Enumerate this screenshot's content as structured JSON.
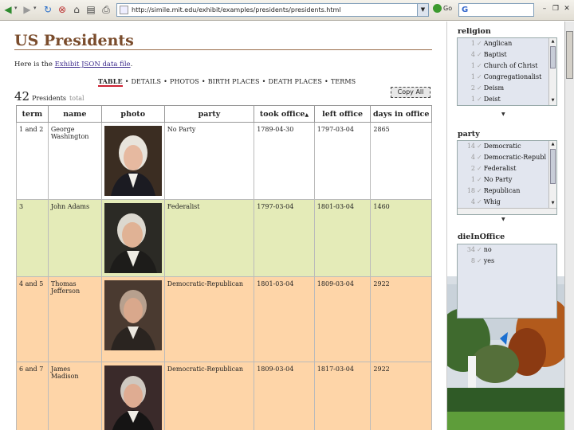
{
  "browser": {
    "url": "http://simile.mit.edu/exhibit/examples/presidents/presidents.html",
    "go_label": "Go",
    "search_logo": "G",
    "page_icon_text": "5"
  },
  "page": {
    "title": "US Presidents",
    "intro_before": "Here is the ",
    "intro_link": "Exhibit JSON data file",
    "intro_after": ".",
    "views": [
      "TABLE",
      "DETAILS",
      "PHOTOS",
      "BIRTH PLACES",
      "DEATH PLACES",
      "TERMS"
    ],
    "count_number": "42",
    "count_label": "Presidents",
    "count_total": "total",
    "copy_all": "Copy All"
  },
  "table": {
    "headers": [
      "term",
      "name",
      "photo",
      "party",
      "took office",
      "left office",
      "days in office"
    ],
    "sort_indicator": "▲",
    "rows": [
      {
        "term": "1 and 2",
        "name": "George Washington",
        "party": "No Party",
        "took": "1789-04-30",
        "left": "1797-03-04",
        "days": "2865"
      },
      {
        "term": "3",
        "name": "John Adams",
        "party": "Federalist",
        "took": "1797-03-04",
        "left": "1801-03-04",
        "days": "1460"
      },
      {
        "term": "4 and 5",
        "name": "Thomas Jefferson",
        "party": "Democratic-Republican",
        "took": "1801-03-04",
        "left": "1809-03-04",
        "days": "2922"
      },
      {
        "term": "6 and 7",
        "name": "James Madison",
        "party": "Democratic-Republican",
        "took": "1809-03-04",
        "left": "1817-03-04",
        "days": "2922"
      }
    ]
  },
  "facets": {
    "religion": {
      "title": "religion",
      "items": [
        {
          "count": "1",
          "label": "Anglican"
        },
        {
          "count": "4",
          "label": "Baptist"
        },
        {
          "count": "1",
          "label": "Church of Christ"
        },
        {
          "count": "1",
          "label": "Congregationalist"
        },
        {
          "count": "2",
          "label": "Deism"
        },
        {
          "count": "1",
          "label": "Deist"
        }
      ]
    },
    "party": {
      "title": "party",
      "items": [
        {
          "count": "14",
          "label": "Democratic"
        },
        {
          "count": "4",
          "label": "Democratic-Republ"
        },
        {
          "count": "2",
          "label": "Federalist"
        },
        {
          "count": "1",
          "label": "No Party"
        },
        {
          "count": "18",
          "label": "Republican"
        },
        {
          "count": "4",
          "label": "Whig"
        }
      ]
    },
    "dieInOffice": {
      "title": "dieInOffice",
      "items": [
        {
          "count": "34",
          "label": "no"
        },
        {
          "count": "8",
          "label": "yes"
        }
      ]
    }
  }
}
